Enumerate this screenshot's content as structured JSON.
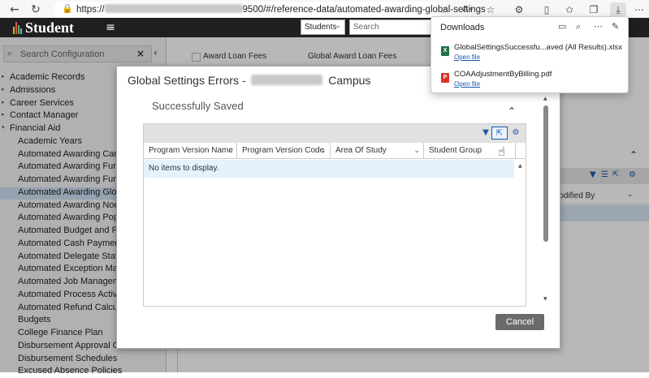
{
  "browser": {
    "url_prefix": "https://",
    "url_suffix": "9500/#/reference-data/automated-awarding-global-settings"
  },
  "app": {
    "logo_text": "Student",
    "scope_select": "Students",
    "search_placeholder": "Search"
  },
  "sidebar": {
    "search_placeholder": "Search Configuration",
    "items": [
      {
        "label": "Academic Records",
        "level": 0,
        "arrow": "▸"
      },
      {
        "label": "Admissions",
        "level": 0,
        "arrow": "▸"
      },
      {
        "label": "Career Services",
        "level": 0,
        "arrow": "▸"
      },
      {
        "label": "Contact Manager",
        "level": 0,
        "arrow": "▸"
      },
      {
        "label": "Financial Aid",
        "level": 0,
        "arrow": "▾"
      },
      {
        "label": "Academic Years",
        "level": 1
      },
      {
        "label": "Automated Awarding Campus",
        "level": 1
      },
      {
        "label": "Automated Awarding Fund Sou",
        "level": 1
      },
      {
        "label": "Automated Awarding Fund Sou",
        "level": 1
      },
      {
        "label": "Automated Awarding Global Se",
        "level": 1,
        "selected": true
      },
      {
        "label": "Automated Awarding Noel Lev",
        "level": 1
      },
      {
        "label": "Automated Awarding Populatio",
        "level": 1
      },
      {
        "label": "Automated Budget and Packag",
        "level": 1
      },
      {
        "label": "Automated Cash Payment Plar",
        "level": 1
      },
      {
        "label": "Automated Delegate Staff Grou",
        "level": 1
      },
      {
        "label": "Automated Exception Manager",
        "level": 1
      },
      {
        "label": "Automated Job Management",
        "level": 1
      },
      {
        "label": "Automated Process Activation",
        "level": 1
      },
      {
        "label": "Automated Refund Calculation",
        "level": 1
      },
      {
        "label": "Budgets",
        "level": 1
      },
      {
        "label": "College Finance Plan",
        "level": 1
      },
      {
        "label": "Disbursement Approval Criter",
        "level": 1
      },
      {
        "label": "Disbursement Schedules",
        "level": 1
      },
      {
        "label": "Excused Absence Policies",
        "level": 1
      }
    ]
  },
  "background": {
    "check_label_1": "Award Loan Fees",
    "check_label_2": "Global Award Loan Fees",
    "col_modified_by": "Modified By"
  },
  "dialog": {
    "title_prefix": "Global Settings Errors - ",
    "title_suffix": " Campus",
    "success_message": "Successfully Saved",
    "cancel_label": "Cancel",
    "grid": {
      "columns": [
        "Program Version Name",
        "Program Version Code",
        "Area Of Study",
        "Student Group"
      ],
      "empty_text": "No items to display."
    }
  },
  "downloads": {
    "title": "Downloads",
    "items": [
      {
        "name": "GlobalSettingsSuccessfu...aved (All Results).xlsx",
        "action": "Open file",
        "type": "xlsx",
        "color": "#1e7145"
      },
      {
        "name": "COAAdjustmentByBilling.pdf",
        "action": "Open file",
        "type": "pdf",
        "color": "#d9342b"
      }
    ]
  },
  "colors": {
    "accent": "#1a5aa8",
    "selected_row": "#cfe1f5",
    "logo_bars": [
      "#e8a33d",
      "#d9534f",
      "#5cb85c",
      "#5bc0de"
    ]
  }
}
